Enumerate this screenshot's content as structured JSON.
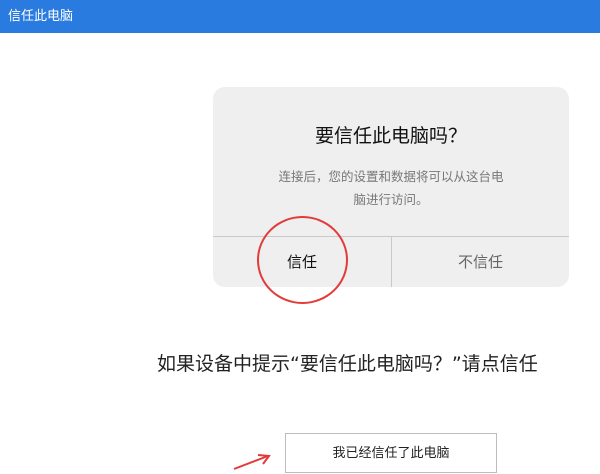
{
  "window": {
    "title": "信任此电脑"
  },
  "dialog": {
    "title": "要信任此电脑吗？",
    "message_line1": "连接后，您的设置和数据将可以从这台电",
    "message_line2": "脑进行访问。",
    "trust_label": "信任",
    "distrust_label": "不信任"
  },
  "instruction": {
    "text": "如果设备中提示“要信任此电脑吗？”请点信任"
  },
  "confirm": {
    "label": "我已经信任了此电脑"
  },
  "colors": {
    "title_bar": "#2a7bdf",
    "highlight_circle": "#e23b3b",
    "dialog_background": "#efefef"
  }
}
